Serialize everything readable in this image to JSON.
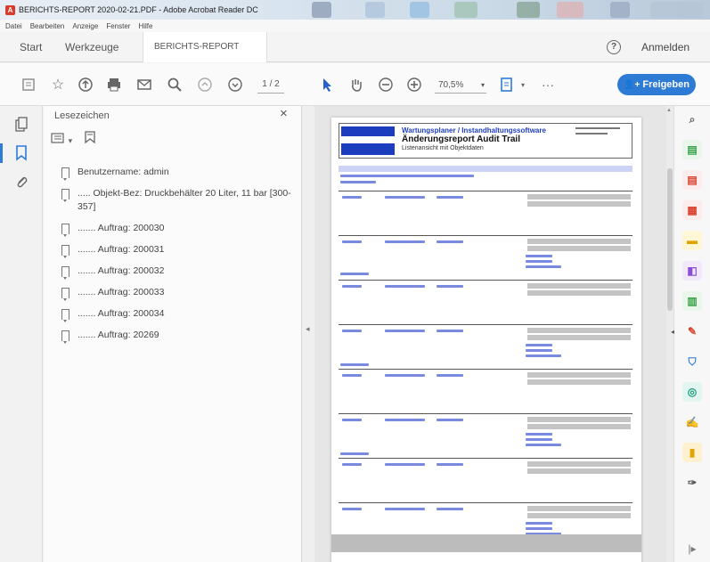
{
  "window": {
    "title": "BERICHTS-REPORT 2020-02-21.PDF - Adobe Acrobat Reader DC"
  },
  "menu": [
    "Datei",
    "Bearbeiten",
    "Anzeige",
    "Fenster",
    "Hilfe"
  ],
  "tabs": {
    "start": "Start",
    "tools": "Werkzeuge",
    "document": "BERICHTS-REPORT ...",
    "close": "×"
  },
  "header": {
    "help": "?",
    "signin": "Anmelden"
  },
  "toolbar": {
    "page_indicator": "1 / 2",
    "zoom": "70,5%",
    "share_label": "Freigeben"
  },
  "bookmarks": {
    "title": "Lesezeichen",
    "close": "×",
    "items": [
      "Benutzername: admin",
      "..... Objekt-Bez: Druckbehälter 20 Liter, 11 bar [300-357]",
      "....... Auftrag: 200030",
      "....... Auftrag: 200031",
      "....... Auftrag: 200032",
      "....... Auftrag: 200033",
      "....... Auftrag: 200034",
      "....... Auftrag: 20269"
    ]
  },
  "document": {
    "header_line1": "Wartungsplaner / Instandhaltungssoftware",
    "header_line2": "Änderungsreport Audit Trail",
    "header_line3": "Listenansicht mit Objektdaten"
  },
  "colors": {
    "accent": "#2e7bd6",
    "doc_blue": "#1d3dbf",
    "doc_band": "#cdd3f5"
  }
}
